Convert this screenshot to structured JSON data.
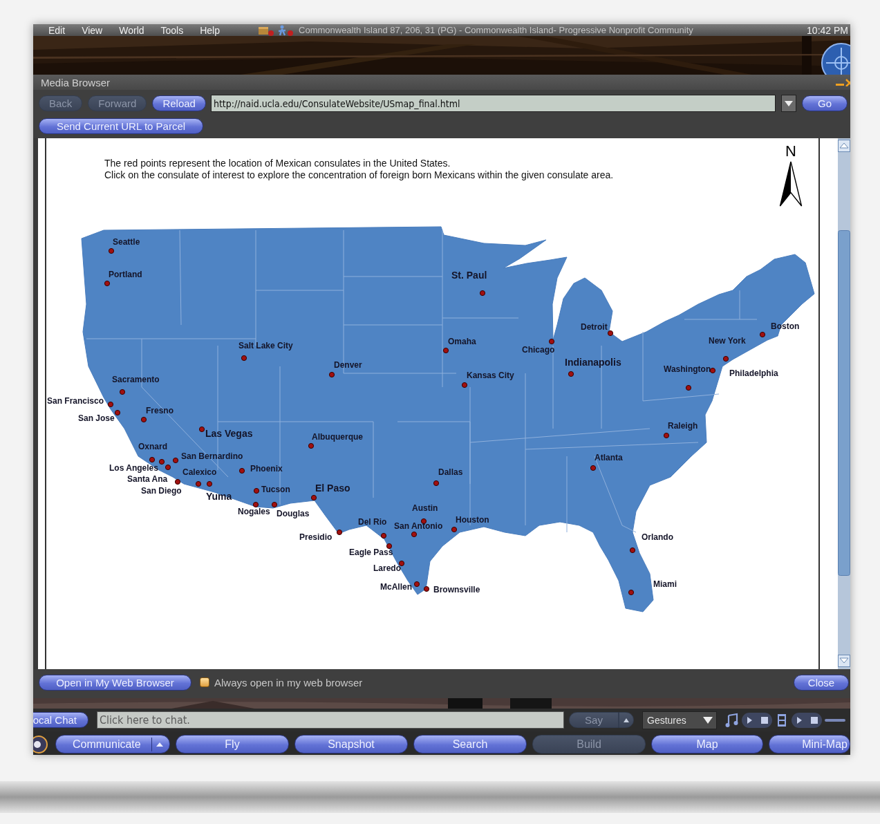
{
  "menu_bar": {
    "items": [
      "Edit",
      "View",
      "World",
      "Tools",
      "Help"
    ],
    "location": "Commonwealth Island 87, 206, 31 (PG) - Commonwealth Island- Progressive Nonprofit Community",
    "time": "10:42 PM"
  },
  "media_browser": {
    "title": "Media Browser",
    "nav_buttons": [
      {
        "label": "Back",
        "disabled": true
      },
      {
        "label": "Forward",
        "disabled": true
      },
      {
        "label": "Reload",
        "disabled": false
      }
    ],
    "url": "http://naid.ucla.edu/ConsulateWebsite/USmap_final.html",
    "go": "Go",
    "send_url": "Send Current URL to Parcel",
    "page": {
      "intro": [
        "The red points represent the location of Mexican consulates in the United States.",
        "Click on the consulate of interest to explore the concentration of foreign born Mexicans within the given consulate area."
      ],
      "north": "N",
      "consulates": [
        {
          "name": "Seattle"
        },
        {
          "name": "Portland"
        },
        {
          "name": "St. Paul"
        },
        {
          "name": "Detroit"
        },
        {
          "name": "Boston"
        },
        {
          "name": "Salt Lake City"
        },
        {
          "name": "Omaha"
        },
        {
          "name": "Chicago"
        },
        {
          "name": "New York"
        },
        {
          "name": "Sacramento"
        },
        {
          "name": "Denver"
        },
        {
          "name": "Kansas City"
        },
        {
          "name": "Indianapolis"
        },
        {
          "name": "Washington"
        },
        {
          "name": "Philadelphia"
        },
        {
          "name": "San Francisco"
        },
        {
          "name": "San Jose"
        },
        {
          "name": "Fresno"
        },
        {
          "name": "Las Vegas"
        },
        {
          "name": "Albuquerque"
        },
        {
          "name": "Raleigh"
        },
        {
          "name": "Oxnard"
        },
        {
          "name": "San Bernardino"
        },
        {
          "name": "Atlanta"
        },
        {
          "name": "Los Angeles"
        },
        {
          "name": "Calexico"
        },
        {
          "name": "Phoenix"
        },
        {
          "name": "Dallas"
        },
        {
          "name": "Santa Ana"
        },
        {
          "name": "San Diego"
        },
        {
          "name": "Yuma"
        },
        {
          "name": "Tucson"
        },
        {
          "name": "El Paso"
        },
        {
          "name": "Nogales"
        },
        {
          "name": "Douglas"
        },
        {
          "name": "Austin"
        },
        {
          "name": "Del Rio"
        },
        {
          "name": "San Antonio"
        },
        {
          "name": "Houston"
        },
        {
          "name": "Presidio"
        },
        {
          "name": "Orlando"
        },
        {
          "name": "Eagle Pass"
        },
        {
          "name": "Laredo"
        },
        {
          "name": "McAllen"
        },
        {
          "name": "Brownsville"
        },
        {
          "name": "Miami"
        }
      ]
    },
    "open_external": "Open in My Web Browser",
    "always_open": {
      "label": "Always open in my web browser",
      "checked": false
    },
    "close": "Close"
  },
  "chat_bar": {
    "channel": "ocal Chat",
    "placeholder": "Click here to chat.",
    "say": {
      "label": "Say",
      "disabled": true
    },
    "gestures": "Gestures"
  },
  "toolbar": [
    {
      "label": "Communicate",
      "kind": "menu",
      "disabled": false
    },
    {
      "label": "Fly",
      "kind": "plain",
      "disabled": false
    },
    {
      "label": "Snapshot",
      "kind": "plain",
      "disabled": false
    },
    {
      "label": "Search",
      "kind": "plain",
      "disabled": false
    },
    {
      "label": "Build",
      "kind": "plain",
      "disabled": true
    },
    {
      "label": "Map",
      "kind": "plain",
      "disabled": false
    },
    {
      "label": "Mini-Map",
      "kind": "plain",
      "disabled": false
    }
  ]
}
